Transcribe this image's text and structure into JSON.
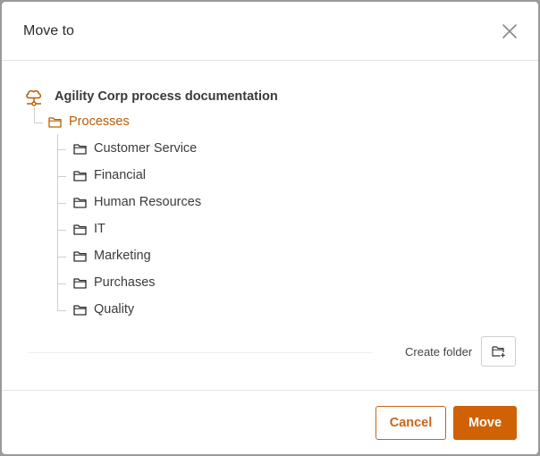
{
  "dialog": {
    "title": "Move to",
    "close_icon": "close-icon"
  },
  "tree": {
    "root": {
      "label": "Agility Corp process documentation",
      "icon": "cloud-network-icon"
    },
    "parent": {
      "label": "Processes",
      "icon": "folder-icon"
    },
    "children": [
      {
        "label": "Customer Service",
        "icon": "folder-icon"
      },
      {
        "label": "Financial",
        "icon": "folder-icon"
      },
      {
        "label": "Human Resources",
        "icon": "folder-icon"
      },
      {
        "label": "IT",
        "icon": "folder-icon"
      },
      {
        "label": "Marketing",
        "icon": "folder-icon"
      },
      {
        "label": "Purchases",
        "icon": "folder-icon"
      },
      {
        "label": "Quality",
        "icon": "folder-icon"
      }
    ]
  },
  "actions": {
    "create_folder_label": "Create folder",
    "create_folder_icon": "folder-plus-icon",
    "cancel_label": "Cancel",
    "move_label": "Move"
  },
  "colors": {
    "accent": "#cf6206",
    "accent_text": "#b85d00"
  }
}
